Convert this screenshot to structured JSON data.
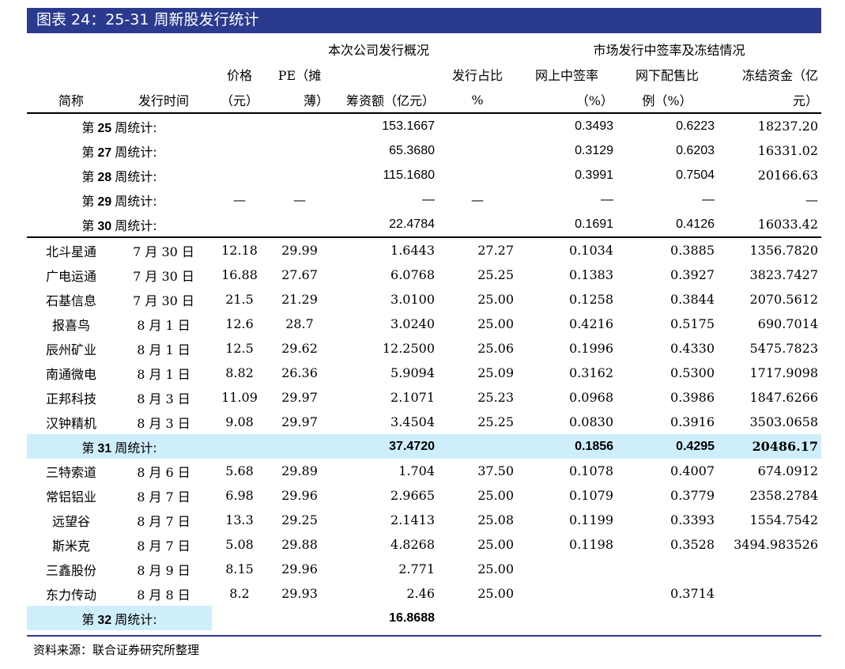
{
  "title": "图表 24：25-31 周新股发行统计",
  "header": {
    "group1": "本次公司发行概况",
    "group2": "市场发行中签率及冻结情况",
    "row2": [
      "价格",
      "PE（摊",
      "",
      "发行占比",
      "网上中签率",
      "网下配售比",
      "冻结资金（亿"
    ],
    "row3": [
      "简称",
      "发行时间",
      "（元）",
      "薄）",
      "筹资额（亿元）",
      "%",
      "（%）",
      "例（%）",
      "元）"
    ]
  },
  "summary_top": [
    {
      "label_pre": "第",
      "week": "25",
      "label_post": "周统计:",
      "price": "",
      "pe": "",
      "amount": "153.1667",
      "ratio": "",
      "online": "0.3493",
      "offline": "0.6223",
      "frozen": "18237.20"
    },
    {
      "label_pre": "第",
      "week": "27",
      "label_post": "周统计:",
      "price": "",
      "pe": "",
      "amount": "65.3680",
      "ratio": "",
      "online": "0.3129",
      "offline": "0.6203",
      "frozen": "16331.02"
    },
    {
      "label_pre": "第",
      "week": "28",
      "label_post": "周统计:",
      "price": "",
      "pe": "",
      "amount": "115.1680",
      "ratio": "",
      "online": "0.3991",
      "offline": "0.7504",
      "frozen": "20166.63"
    },
    {
      "label_pre": "第",
      "week": "29",
      "label_post": "周统计:",
      "price": "—",
      "pe": "—",
      "amount": "—",
      "ratio": "—",
      "online": "—",
      "offline": "—",
      "frozen": "—"
    },
    {
      "label_pre": "第",
      "week": "30",
      "label_post": "周统计:",
      "price": "",
      "pe": "",
      "amount": "22.4784",
      "ratio": "",
      "online": "0.1691",
      "offline": "0.4126",
      "frozen": "16033.42"
    }
  ],
  "week31_rows": [
    {
      "name": "北斗星通",
      "date": "7 月 30 日",
      "price": "12.18",
      "pe": "29.99",
      "amount": "1.6443",
      "ratio": "27.27",
      "online": "0.1034",
      "offline": "0.3885",
      "frozen": "1356.7820"
    },
    {
      "name": "广电运通",
      "date": "7 月 30 日",
      "price": "16.88",
      "pe": "27.67",
      "amount": "6.0768",
      "ratio": "25.25",
      "online": "0.1383",
      "offline": "0.3927",
      "frozen": "3823.7427"
    },
    {
      "name": "石基信息",
      "date": "7 月 30 日",
      "price": "21.5",
      "pe": "21.29",
      "amount": "3.0100",
      "ratio": "25.00",
      "online": "0.1258",
      "offline": "0.3844",
      "frozen": "2070.5612"
    },
    {
      "name": "报喜鸟",
      "date": "8 月 1 日",
      "price": "12.6",
      "pe": "28.7",
      "amount": "3.0240",
      "ratio": "25.00",
      "online": "0.4216",
      "offline": "0.5175",
      "frozen": "690.7014"
    },
    {
      "name": "辰州矿业",
      "date": "8 月 1 日",
      "price": "12.5",
      "pe": "29.62",
      "amount": "12.2500",
      "ratio": "25.06",
      "online": "0.1996",
      "offline": "0.4330",
      "frozen": "5475.7823"
    },
    {
      "name": "南通微电",
      "date": "8 月 1 日",
      "price": "8.82",
      "pe": "26.36",
      "amount": "5.9094",
      "ratio": "25.09",
      "online": "0.3162",
      "offline": "0.5300",
      "frozen": "1717.9098"
    },
    {
      "name": "正邦科技",
      "date": "8 月 3 日",
      "price": "11.09",
      "pe": "29.97",
      "amount": "2.1071",
      "ratio": "25.23",
      "online": "0.0968",
      "offline": "0.3986",
      "frozen": "1847.6266"
    },
    {
      "name": "汉钟精机",
      "date": "8 月 3 日",
      "price": "9.08",
      "pe": "29.97",
      "amount": "3.4504",
      "ratio": "25.25",
      "online": "0.0830",
      "offline": "0.3916",
      "frozen": "3503.0658"
    }
  ],
  "week31_summary": {
    "label_pre": "第",
    "week": "31",
    "label_post": "周统计:",
    "amount": "37.4720",
    "online": "0.1856",
    "offline": "0.4295",
    "frozen": "20486.17"
  },
  "week32_rows": [
    {
      "name": "三特索道",
      "date": "8 月 6 日",
      "price": "5.68",
      "pe": "29.89",
      "amount": "1.704",
      "ratio": "37.50",
      "online": "0.1078",
      "offline": "0.4007",
      "frozen": "674.0912"
    },
    {
      "name": "常铝铝业",
      "date": "8 月 7 日",
      "price": "6.98",
      "pe": "29.96",
      "amount": "2.9665",
      "ratio": "25.00",
      "online": "0.1079",
      "offline": "0.3779",
      "frozen": "2358.2784"
    },
    {
      "name": "远望谷",
      "date": "8 月 7 日",
      "price": "13.3",
      "pe": "29.25",
      "amount": "2.1413",
      "ratio": "25.08",
      "online": "0.1199",
      "offline": "0.3393",
      "frozen": "1554.7542"
    },
    {
      "name": "斯米克",
      "date": "8 月 7 日",
      "price": "5.08",
      "pe": "29.88",
      "amount": "4.8268",
      "ratio": "25.00",
      "online": "0.1198",
      "offline": "0.3528",
      "frozen": "3494.983526"
    },
    {
      "name": "三鑫股份",
      "date": "8 月 9 日",
      "price": "8.15",
      "pe": "29.96",
      "amount": "2.771",
      "ratio": "25.00",
      "online": "",
      "offline": "",
      "frozen": ""
    },
    {
      "name": "东力传动",
      "date": "8 月 8 日",
      "price": "8.2",
      "pe": "29.93",
      "amount": "2.46",
      "ratio": "25.00",
      "online": "",
      "offline": "0.3714",
      "frozen": ""
    }
  ],
  "week32_summary": {
    "label_pre": "第",
    "week": "32",
    "label_post": "周统计:",
    "amount": "16.8688"
  },
  "source": "资料来源：联合证券研究所整理"
}
